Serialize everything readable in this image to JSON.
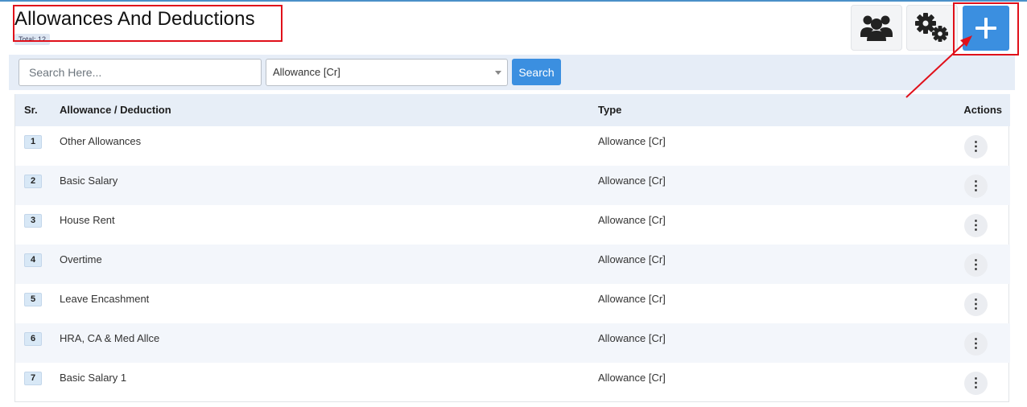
{
  "page": {
    "title": "Allowances And Deductions",
    "total_label": "Total: 12"
  },
  "toolbar": {
    "users_icon": "users-icon",
    "settings_icon": "gears-icon",
    "add_icon": "plus-icon"
  },
  "search": {
    "placeholder": "Search Here...",
    "value": "",
    "type_selected": "Allowance [Cr]",
    "button_label": "Search"
  },
  "table": {
    "headers": {
      "sr": "Sr.",
      "name": "Allowance / Deduction",
      "type": "Type",
      "actions": "Actions"
    },
    "rows": [
      {
        "sr": "1",
        "name": "Other Allowances",
        "type": "Allowance [Cr]"
      },
      {
        "sr": "2",
        "name": "Basic Salary",
        "type": "Allowance [Cr]"
      },
      {
        "sr": "3",
        "name": "House Rent",
        "type": "Allowance [Cr]"
      },
      {
        "sr": "4",
        "name": "Overtime",
        "type": "Allowance [Cr]"
      },
      {
        "sr": "5",
        "name": "Leave Encashment",
        "type": "Allowance [Cr]"
      },
      {
        "sr": "6",
        "name": "HRA, CA & Med Allce",
        "type": "Allowance [Cr]"
      },
      {
        "sr": "7",
        "name": "Basic Salary 1",
        "type": "Allowance [Cr]"
      }
    ],
    "action_glyph": "⋮"
  },
  "colors": {
    "accent": "#3b8fe0",
    "annotation": "#e0101a",
    "header_bg": "#e7eef7",
    "alt_row_bg": "#f3f6fb"
  }
}
